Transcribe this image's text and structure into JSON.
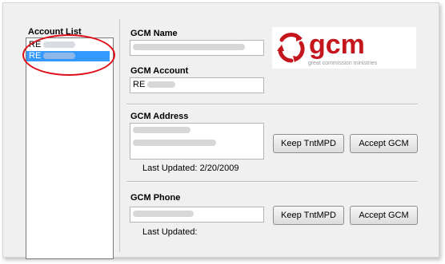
{
  "account_list": {
    "title": "Account List",
    "items": [
      {
        "prefix": "RE",
        "selected": false
      },
      {
        "prefix": "RE",
        "selected": true
      }
    ]
  },
  "gcm_name": {
    "label": "GCM Name"
  },
  "gcm_account": {
    "label": "GCM Account",
    "prefix": "RE"
  },
  "gcm_address": {
    "label": "GCM Address",
    "keep_button": "Keep TntMPD",
    "accept_button": "Accept GCM",
    "last_updated_label": "Last Updated:",
    "last_updated_value": "2/20/2009"
  },
  "gcm_phone": {
    "label": "GCM Phone",
    "keep_button": "Keep TntMPD",
    "accept_button": "Accept GCM",
    "last_updated_label": "Last Updated:",
    "last_updated_value": ""
  },
  "logo": {
    "wordmark": "gcm",
    "tagline": "great commission ministries",
    "brand_color": "#c4161c",
    "icon": "gcm-swirl-logo"
  },
  "colors": {
    "selection": "#3399ff",
    "highlight_circle": "#e0101a"
  }
}
